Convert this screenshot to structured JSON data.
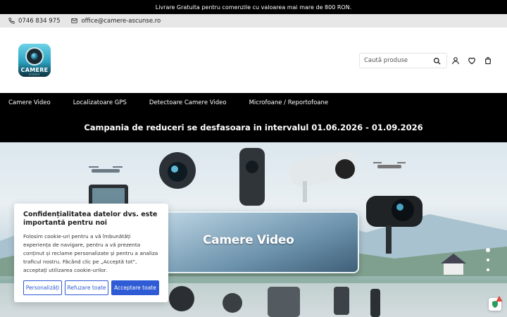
{
  "topbar": {
    "text": "Livrare Gratuita pentru comenzile cu valoarea mai mare de 800 RON."
  },
  "contact": {
    "phone": "0746 834 975",
    "email": "office@camere-ascunse.ro",
    "phone_icon": "phone-icon",
    "email_icon": "envelope-icon"
  },
  "header": {
    "logo_text": "CAMERE",
    "logo_sub": "VIDEO",
    "search_placeholder": "Caută produse",
    "icons": [
      "search-icon",
      "user-icon",
      "heart-icon",
      "bag-icon"
    ]
  },
  "nav": {
    "items": [
      "Camere Video",
      "Localizatoare GPS",
      "Detectoare Camere Video",
      "Microfoane / Reportofoane"
    ]
  },
  "promo": {
    "text": "Campania de reduceri se desfasoara in intervalul 01.06.2026 - 01.09.2026"
  },
  "hero": {
    "title": "Camere Video",
    "slides_count": 3,
    "active_slide": 1
  },
  "cookie": {
    "title": "Confidențialitatea datelor dvs. este importantă pentru noi",
    "text": "Folosim cookie-uri pentru a vă îmbunătăți experiența de navigare, pentru a vă prezenta conținut și reclame personalizate și pentru a analiza traficul nostru. Făcând clic pe „Acceptă tot\", acceptați utilizarea cookie-urilor.",
    "btn_customize": "Personalizăți",
    "btn_reject": "Refuzare toate",
    "btn_accept": "Acceptare toate"
  },
  "colors": {
    "accent": "#2f5bd5",
    "bar": "#000000",
    "contact_bg": "#e7e7e7"
  }
}
